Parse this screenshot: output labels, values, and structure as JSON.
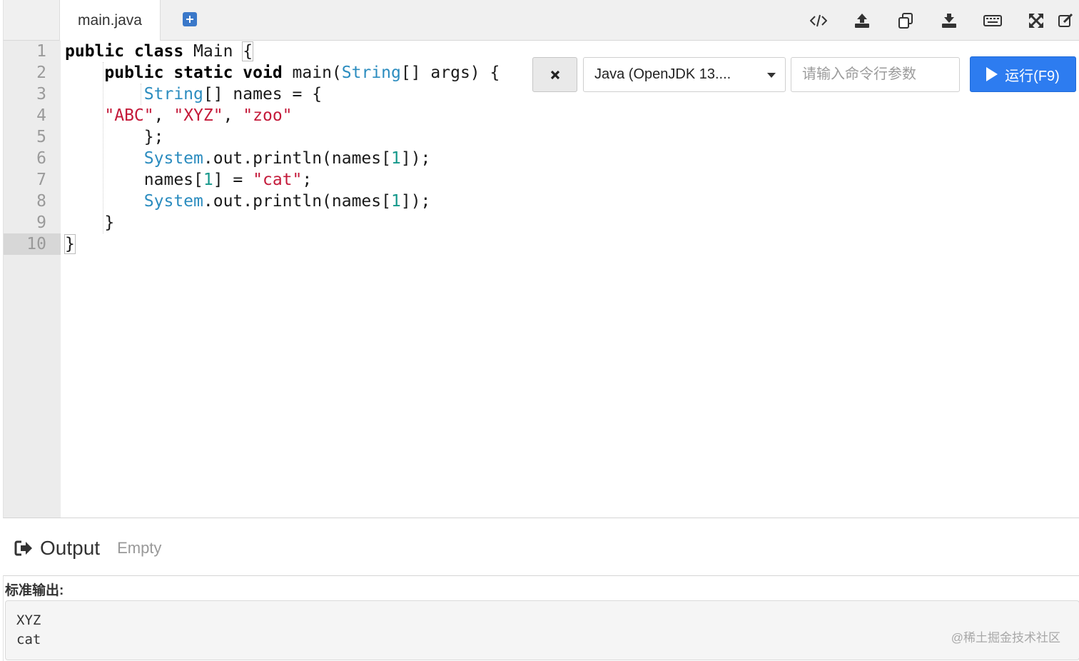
{
  "tabs": {
    "active_file": "main.java"
  },
  "toolbar": {
    "icons": [
      "code-icon",
      "upload-icon",
      "copy-icon",
      "download-icon",
      "keyboard-icon",
      "fullscreen-icon",
      "edit-icon"
    ]
  },
  "editor": {
    "active_line": 10,
    "line_numbers": [
      "1",
      "2",
      "3",
      "4",
      "5",
      "6",
      "7",
      "8",
      "9",
      "10"
    ],
    "lines": [
      "public class Main {",
      "    public static void main(String[] args) {",
      "        String[] names = {",
      "    \"ABC\", \"XYZ\", \"zoo\"",
      "        };",
      "        System.out.println(names[1]);",
      "        names[1] = \"cat\";",
      "        System.out.println(names[1]);",
      "    }",
      "}"
    ]
  },
  "run_controls": {
    "language_selected": "Java (OpenJDK 13....",
    "args_placeholder": "请输入命令行参数",
    "args_value": "",
    "run_label": "运行(F9)"
  },
  "output": {
    "title": "Output",
    "status": "Empty",
    "stdout_label": "标准输出:",
    "stdout_lines": [
      "XYZ",
      "cat"
    ]
  },
  "watermark": "@稀土掘金技术社区",
  "colors": {
    "run_button": "#2d7cf0",
    "keyword": "#000000",
    "type": "#2b8cbf",
    "string": "#c41a3a",
    "number": "#15988b"
  }
}
